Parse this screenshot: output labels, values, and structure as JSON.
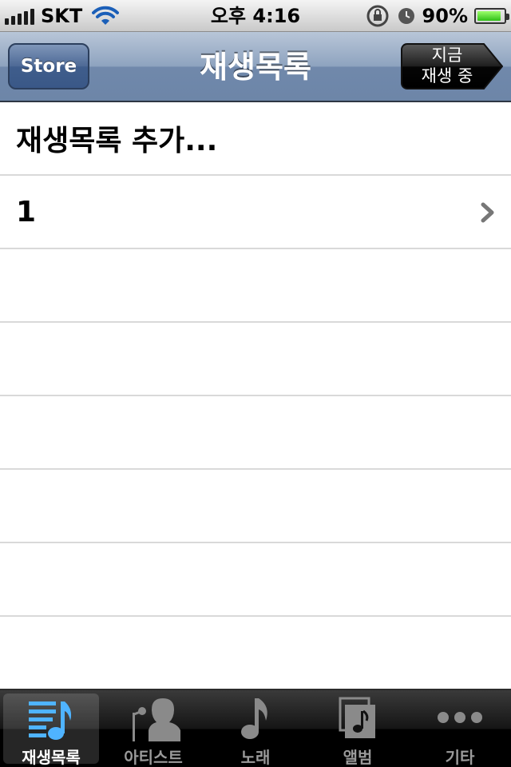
{
  "status_bar": {
    "carrier": "SKT",
    "time": "오후 4:16",
    "battery": "90%",
    "battery_level": 0.9
  },
  "nav": {
    "title": "재생목록",
    "store_button": "Store",
    "now_playing_line1": "지금",
    "now_playing_line2": "재생 중"
  },
  "list": {
    "rows": [
      {
        "label": "재생목록 추가..."
      },
      {
        "label": "1"
      },
      {
        "label": ""
      },
      {
        "label": ""
      },
      {
        "label": ""
      },
      {
        "label": ""
      },
      {
        "label": ""
      },
      {
        "label": ""
      }
    ]
  },
  "tabs": [
    {
      "label": "재생목록",
      "icon": "playlist-icon",
      "active": true
    },
    {
      "label": "아티스트",
      "icon": "artist-icon",
      "active": false
    },
    {
      "label": "노래",
      "icon": "song-icon",
      "active": false
    },
    {
      "label": "앨범",
      "icon": "album-icon",
      "active": false
    },
    {
      "label": "기타",
      "icon": "more-icon",
      "active": false
    }
  ],
  "colors": {
    "active_tab_icon": "#4fb3ff",
    "inactive_tab_icon": "#8a8a8a",
    "nav_bar": "#8ea3bf"
  }
}
